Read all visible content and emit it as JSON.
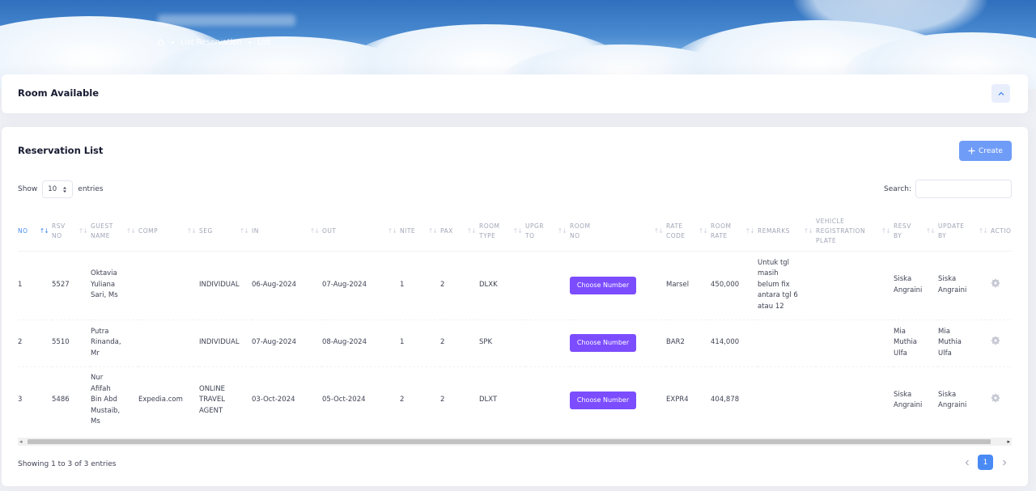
{
  "breadcrumb": {
    "items": [
      "List Reservation",
      "List"
    ]
  },
  "room_card": {
    "title": "Room Available"
  },
  "reservation_card": {
    "title": "Reservation List",
    "create_label": "Create",
    "show_label": "Show",
    "page_size": "10",
    "entries_label": "entries",
    "search_label": "Search:",
    "search_value": ""
  },
  "table": {
    "columns": [
      [
        "NO"
      ],
      [
        "RSV",
        "NO"
      ],
      [
        "GUEST",
        "NAME"
      ],
      [
        "COMP"
      ],
      [
        "SEG"
      ],
      [
        "IN"
      ],
      [
        "OUT"
      ],
      [
        "NITE"
      ],
      [
        "PAX"
      ],
      [
        "ROOM",
        "TYPE"
      ],
      [
        "UPGR",
        "TO"
      ],
      [
        "ROOM",
        "NO"
      ],
      [
        "RATE",
        "CODE"
      ],
      [
        "ROOM",
        "RATE"
      ],
      [
        "REMARKS"
      ],
      [
        "VEHICLE",
        "REGISTRATION",
        "PLATE"
      ],
      [
        "RESV",
        "BY"
      ],
      [
        "UPDATE",
        "BY"
      ],
      [
        "ACTIO"
      ]
    ],
    "rows": [
      {
        "no": "1",
        "rsv_no": "5527",
        "guest": [
          "Oktavia",
          "Yuliana",
          "Sari, Ms"
        ],
        "comp": "",
        "seg": [
          "INDIVIDUAL"
        ],
        "in": "06-Aug-2024",
        "out": "07-Aug-2024",
        "nite": "1",
        "pax": "2",
        "room_type": "DLXK",
        "upgr": "",
        "room_no": "Choose Number",
        "rate_code": "Marsel",
        "room_rate": "450,000",
        "remarks": [
          "Untuk tgl",
          "masih",
          "belum fix",
          "antara tgl 6",
          "atau 12"
        ],
        "vehicle": "",
        "resv_by": [
          "Siska",
          "Angraini"
        ],
        "update_by": [
          "Siska",
          "Angraini"
        ]
      },
      {
        "no": "2",
        "rsv_no": "5510",
        "guest": [
          "Putra",
          "Rinanda,",
          "Mr"
        ],
        "comp": "",
        "seg": [
          "INDIVIDUAL"
        ],
        "in": "07-Aug-2024",
        "out": "08-Aug-2024",
        "nite": "1",
        "pax": "2",
        "room_type": "SPK",
        "upgr": "",
        "room_no": "Choose Number",
        "rate_code": "BAR2",
        "room_rate": "414,000",
        "remarks": [],
        "vehicle": "",
        "resv_by": [
          "Mia",
          "Muthia",
          "Ulfa"
        ],
        "update_by": [
          "Mia",
          "Muthia",
          "Ulfa"
        ]
      },
      {
        "no": "3",
        "rsv_no": "5486",
        "guest": [
          "Nur",
          "Afifah",
          "Bin Abd",
          "Mustaib,",
          "Ms"
        ],
        "comp": "Expedia.com",
        "seg": [
          "ONLINE",
          "TRAVEL",
          "AGENT"
        ],
        "in": "03-Oct-2024",
        "out": "05-Oct-2024",
        "nite": "2",
        "pax": "2",
        "room_type": "DLXT",
        "upgr": "",
        "room_no": "Choose Number",
        "rate_code": "EXPR4",
        "room_rate": "404,878",
        "remarks": [],
        "vehicle": "",
        "resv_by": [
          "Siska",
          "Angraini"
        ],
        "update_by": [
          "Siska",
          "Angraini"
        ]
      }
    ]
  },
  "footer": {
    "info": "Showing 1 to 3 of 3 entries",
    "current_page": "1"
  },
  "icons": {
    "home": "home-icon",
    "collapse": "chevron-up-icon",
    "create": "plus-icon",
    "select": "sort-arrows-icon",
    "action": "gear-icon",
    "prev": "chevron-left-icon",
    "next": "chevron-right-icon"
  },
  "colors": {
    "primary": "#4a8af4",
    "choose_button": "#7c4dff",
    "create_button": "#6f9cf7"
  }
}
